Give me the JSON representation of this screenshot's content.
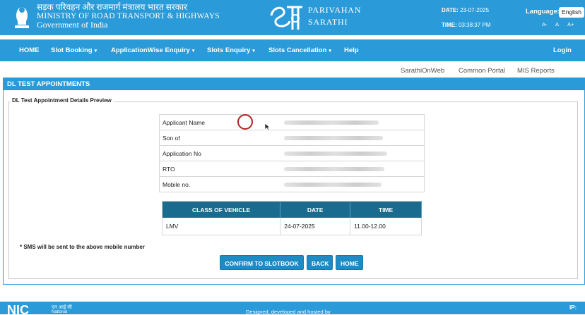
{
  "header": {
    "ministry_hindi": "सड़क परिवहन और राजमार्ग मंत्रालय भारत सरकार",
    "ministry_english": "MINISTRY OF ROAD TRANSPORT & HIGHWAYS",
    "government": "Government of India",
    "app_name_line1": "PARIVAHAN",
    "app_name_line2": "SARATHI",
    "date_label": "DATE:",
    "date_value": "23-07-2025",
    "time_label": "TIME:",
    "time_value": "03:38:37 PM",
    "language_label": "Language:",
    "language_value": "English",
    "font_sizes": [
      "A-",
      "A",
      "A+"
    ]
  },
  "nav": {
    "items": [
      {
        "label": "HOME",
        "dropdown": false
      },
      {
        "label": "Slot Booking",
        "dropdown": true
      },
      {
        "label": "ApplicationWise Enquiry",
        "dropdown": true
      },
      {
        "label": "Slots Enquiry",
        "dropdown": true
      },
      {
        "label": "Slots Cancellation",
        "dropdown": true
      },
      {
        "label": "Help",
        "dropdown": false
      }
    ],
    "login": "Login",
    "caret": "▾"
  },
  "links": [
    "SarathiOnWeb",
    "Common Portal",
    "MIS Reports"
  ],
  "panel": {
    "title": "DL TEST APPOINTMENTS",
    "legend": "DL Test Appointment Details Preview"
  },
  "details": [
    {
      "label": "Applicant Name",
      "value_hidden": true
    },
    {
      "label": "Son of",
      "value_hidden": true
    },
    {
      "label": "Application No",
      "value_hidden": true
    },
    {
      "label": "RTO",
      "value_hidden": true
    },
    {
      "label": "Mobile no.",
      "value_hidden": true
    }
  ],
  "slot_table": {
    "headers": [
      "CLASS OF VEHICLE",
      "DATE",
      "TIME"
    ],
    "rows": [
      [
        "LMV",
        "24-07-2025",
        "11.00-12.00"
      ]
    ]
  },
  "note": "* SMS will be sent to the above mobile number",
  "buttons": {
    "confirm": "CONFIRM TO SLOTBOOK",
    "back": "BACK",
    "home": "HOME"
  },
  "footer": {
    "nic_hindi": "एन आई सी",
    "nic_english": "National",
    "credit": "Designed, developed and hosted by",
    "ip_label": "IP:"
  },
  "colors": {
    "primary": "#2a9bd8",
    "table_header": "#1a6c8f",
    "button": "#1f8bc5"
  }
}
